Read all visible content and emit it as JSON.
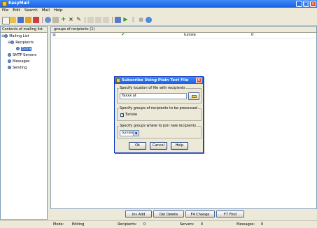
{
  "window": {
    "title": "EasyMail"
  },
  "menu": [
    "File",
    "Edit",
    "Search",
    "Mail",
    "Help"
  ],
  "left": {
    "header": "Contents of mailing list",
    "tree": [
      "Mailing List",
      "Recipients",
      "Extra",
      "SMTP Servers",
      "Messages",
      "Sending"
    ]
  },
  "right": {
    "columns": [
      "groups of recipients (1)"
    ],
    "row": {
      "name": "tunisie",
      "count": "0"
    }
  },
  "buttons": {
    "add": "Ins Add",
    "delete": "Del Delete",
    "change": "F4 Change",
    "find": "F7 Find"
  },
  "status": {
    "mode_label": "Mode:",
    "mode_value": "Editing",
    "recipients_label": "Recipients:",
    "recipients_value": "0",
    "servers_label": "Servers:",
    "servers_value": "0",
    "messages_label": "Messages:",
    "messages_value": "0"
  },
  "dialog": {
    "title": "Subscribe Using Plain Text File",
    "file_legend": "Specify location of file with recipients",
    "file_value": "Taxxx at",
    "groups_legend": "Specify groups of recipients to be processed",
    "checkbox_label": "Tunisie",
    "checkbox_checked": true,
    "join_legend": "Specify groups where to join new recipients",
    "join_value": "tunisie",
    "ok": "Ok",
    "cancel": "Cancel",
    "help": "Help"
  }
}
